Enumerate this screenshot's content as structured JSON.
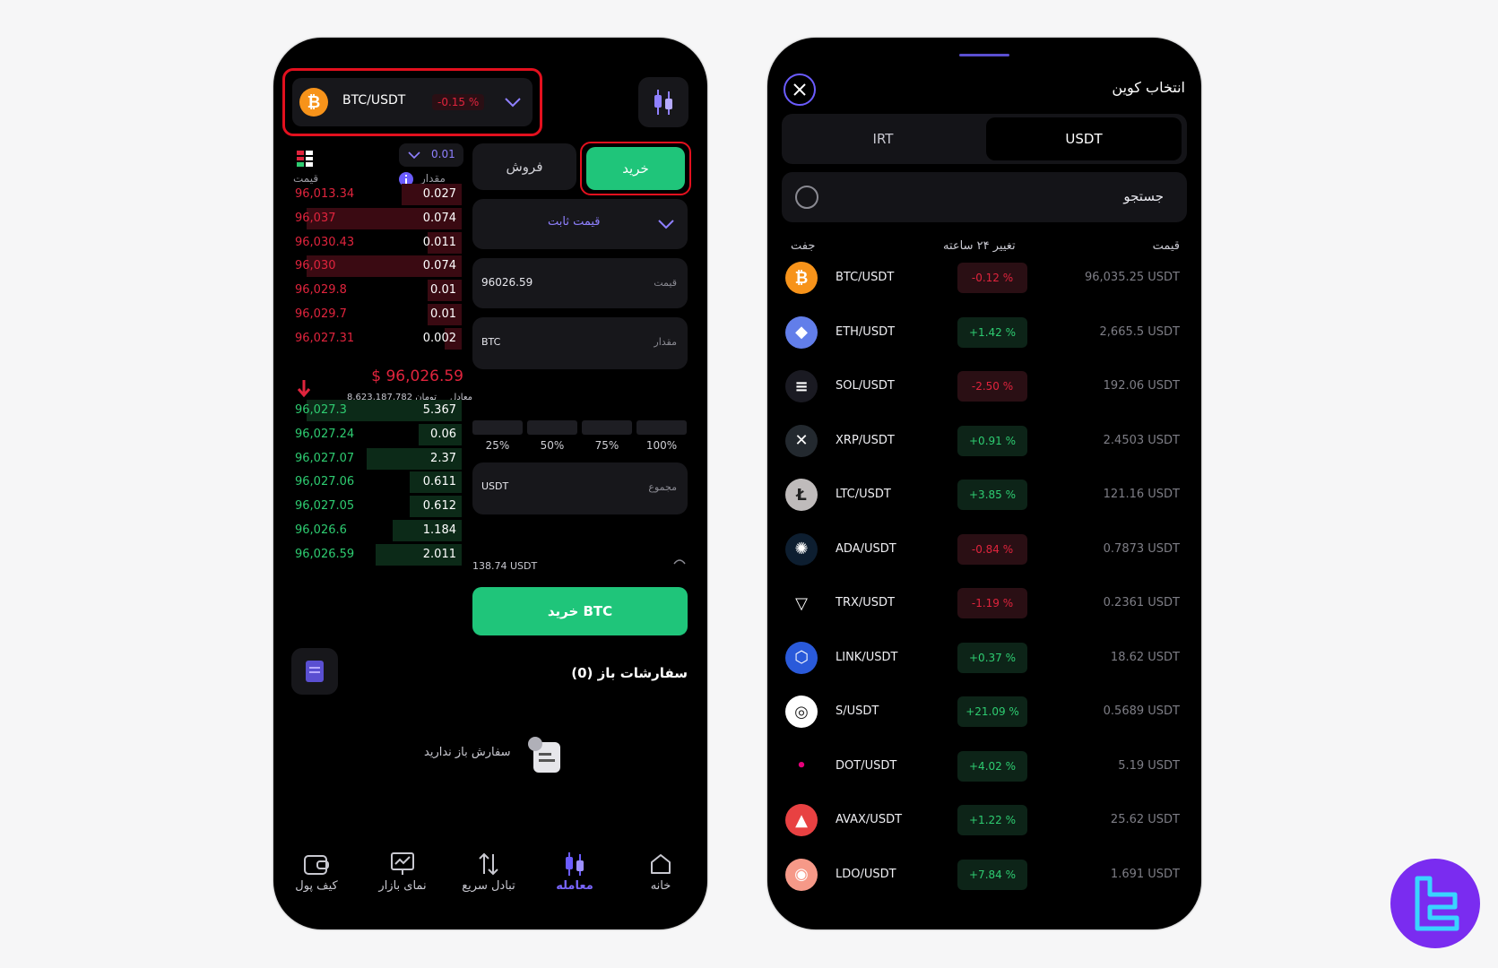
{
  "left": {
    "pair": {
      "symbol": "BTC/USDT",
      "change": "-0.15 %"
    },
    "orderbook": {
      "step": "0.01",
      "col_price": "قیمت",
      "col_amount": "مقدار",
      "asks": [
        {
          "price": "96,013.34",
          "qty": "0.027",
          "depth": 0.35
        },
        {
          "price": "96,037",
          "qty": "0.074",
          "depth": 0.9
        },
        {
          "price": "96,030.43",
          "qty": "0.011",
          "depth": 0.2
        },
        {
          "price": "96,030",
          "qty": "0.074",
          "depth": 0.9
        },
        {
          "price": "96,029.8",
          "qty": "0.01",
          "depth": 0.2
        },
        {
          "price": "96,029.7",
          "qty": "0.01",
          "depth": 0.2
        },
        {
          "price": "96,027.31",
          "qty": "0.002",
          "depth": 0.1
        }
      ],
      "last_price": "$ 96,026.59",
      "equiv_label": "معادل",
      "equiv_value": "8,623,187,782 تومان",
      "bids": [
        {
          "price": "96,027.3",
          "qty": "5.367",
          "depth": 0.9
        },
        {
          "price": "96,027.24",
          "qty": "0.06",
          "depth": 0.25
        },
        {
          "price": "96,027.07",
          "qty": "2.37",
          "depth": 0.55
        },
        {
          "price": "96,027.06",
          "qty": "0.611",
          "depth": 0.3
        },
        {
          "price": "96,027.05",
          "qty": "0.612",
          "depth": 0.3
        },
        {
          "price": "96,026.6",
          "qty": "1.184",
          "depth": 0.4
        },
        {
          "price": "96,026.59",
          "qty": "2.011",
          "depth": 0.5
        }
      ]
    },
    "tabs": {
      "sell": "فروش",
      "buy": "خرید"
    },
    "order_type": "قیمت ثابت",
    "price_field": {
      "label": "قیمت",
      "value": "96026.59"
    },
    "amount_field": {
      "label": "مقدار",
      "unit": "BTC"
    },
    "percentages": [
      "25%",
      "50%",
      "75%",
      "100%"
    ],
    "total_field": {
      "label": "مجموع",
      "unit": "USDT"
    },
    "balance": "138.74 USDT",
    "buy_button": "خرید BTC",
    "open_orders_title": "سفارشات باز (0)",
    "empty_orders": "سفارش باز ندارید",
    "nav": [
      "کیف پول",
      "نمای بازار",
      "تبادل سریع",
      "معامله",
      "خانه"
    ]
  },
  "right": {
    "title": "انتخاب کوین",
    "segments": [
      "IRT",
      "USDT"
    ],
    "search_placeholder": "جستجو",
    "headers": {
      "pair": "جفت",
      "change": "تغییر ۲۴ ساعته",
      "price": "قیمت"
    },
    "coins": [
      {
        "pair": "BTC/USDT",
        "change": "-0.12 %",
        "dir": "neg",
        "price": "96,035.25 USDT",
        "icon": "bitcoin-icon",
        "color": "#f7931a",
        "glyph": "₿"
      },
      {
        "pair": "ETH/USDT",
        "change": "+1.42 %",
        "dir": "pos",
        "price": "2,665.5 USDT",
        "icon": "ethereum-icon",
        "color": "#627eea",
        "glyph": "◆"
      },
      {
        "pair": "SOL/USDT",
        "change": "-2.50 %",
        "dir": "neg",
        "price": "192.06 USDT",
        "icon": "solana-icon",
        "color": "#1a1a22",
        "glyph": "≡"
      },
      {
        "pair": "XRP/USDT",
        "change": "+0.91 %",
        "dir": "pos",
        "price": "2.4503 USDT",
        "icon": "xrp-icon",
        "color": "#23292f",
        "glyph": "✕"
      },
      {
        "pair": "LTC/USDT",
        "change": "+3.85 %",
        "dir": "pos",
        "price": "121.16 USDT",
        "icon": "litecoin-icon",
        "color": "#bfbbbb",
        "glyph": "Ł"
      },
      {
        "pair": "ADA/USDT",
        "change": "-0.84 %",
        "dir": "neg",
        "price": "0.7873 USDT",
        "icon": "cardano-icon",
        "color": "#0d1e30",
        "glyph": "✺"
      },
      {
        "pair": "TRX/USDT",
        "change": "-1.19 %",
        "dir": "neg",
        "price": "0.2361 USDT",
        "icon": "tron-icon",
        "color": "#000000",
        "glyph": "▽"
      },
      {
        "pair": "LINK/USDT",
        "change": "+0.37 %",
        "dir": "pos",
        "price": "18.62 USDT",
        "icon": "chainlink-icon",
        "color": "#2a5ada",
        "glyph": "⬡"
      },
      {
        "pair": "S/USDT",
        "change": "+21.09 %",
        "dir": "pos",
        "price": "0.5689 USDT",
        "icon": "sonic-icon",
        "color": "#ffffff",
        "glyph": "◎"
      },
      {
        "pair": "DOT/USDT",
        "change": "+4.02 %",
        "dir": "pos",
        "price": "5.19 USDT",
        "icon": "polkadot-icon",
        "color": "#000000",
        "glyph": "•"
      },
      {
        "pair": "AVAX/USDT",
        "change": "+1.22 %",
        "dir": "pos",
        "price": "25.62 USDT",
        "icon": "avalanche-icon",
        "color": "#e84142",
        "glyph": "▲"
      },
      {
        "pair": "LDO/USDT",
        "change": "+7.84 %",
        "dir": "pos",
        "price": "1.691 USDT",
        "icon": "lido-icon",
        "color": "#f69988",
        "glyph": "◉"
      }
    ]
  }
}
